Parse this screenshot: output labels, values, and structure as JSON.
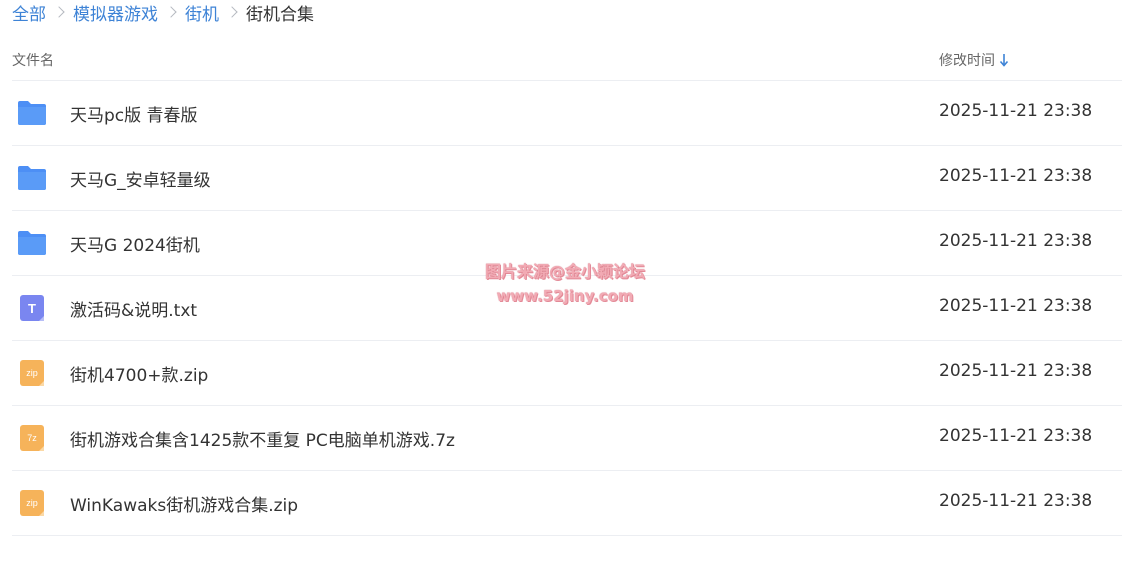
{
  "breadcrumb": {
    "items": [
      "全部",
      "模拟器游戏",
      "街机"
    ],
    "current": "街机合集"
  },
  "table_header": {
    "name_label": "文件名",
    "time_label": "修改时间"
  },
  "files": [
    {
      "name": "天马pc版 青春版",
      "time": "2025-11-21 23:38",
      "type": "folder"
    },
    {
      "name": "天马G_安卓轻量级",
      "time": "2025-11-21 23:38",
      "type": "folder"
    },
    {
      "name": "天马G 2024街机",
      "time": "2025-11-21 23:38",
      "type": "folder"
    },
    {
      "name": "激活码&说明.txt",
      "time": "2025-11-21 23:38",
      "type": "txt",
      "badge": "T"
    },
    {
      "name": "街机4700+款.zip",
      "time": "2025-11-21 23:38",
      "type": "zip",
      "badge": "zip"
    },
    {
      "name": "街机游戏合集含1425款不重复 PC电脑单机游戏.7z",
      "time": "2025-11-21 23:38",
      "type": "7z",
      "badge": "7z"
    },
    {
      "name": "WinKawaks街机游戏合集.zip",
      "time": "2025-11-21 23:38",
      "type": "zip",
      "badge": "zip"
    }
  ],
  "watermark": {
    "line1": "图片来源@金小颖论坛",
    "line2": "www.52jiny.com"
  },
  "colors": {
    "link": "#3e83d6",
    "folder": "#4d8ff5",
    "txt": "#7a86f0",
    "archive": "#f6b35a"
  }
}
